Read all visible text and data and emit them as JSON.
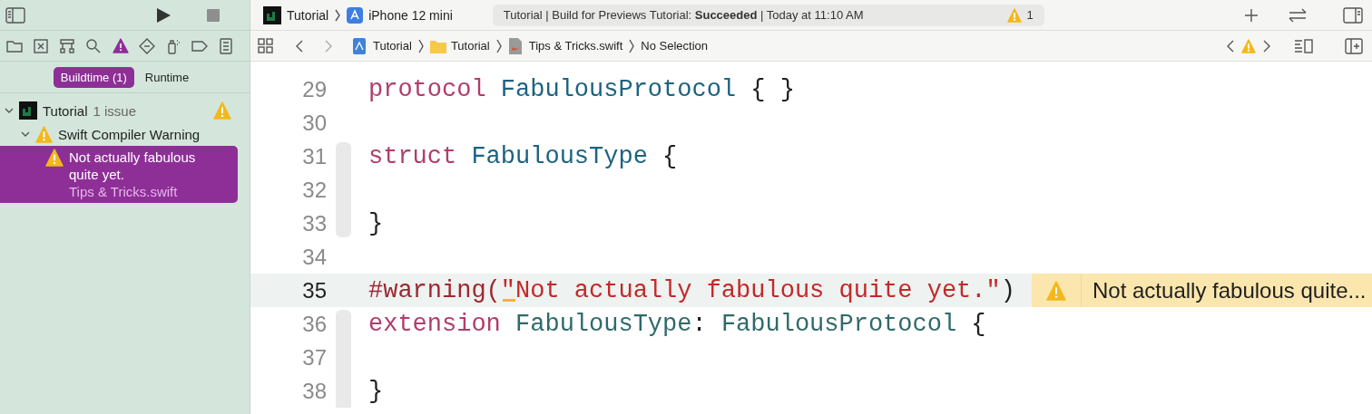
{
  "toolbar": {
    "scheme": "Tutorial",
    "device": "iPhone 12 mini",
    "status": "Tutorial | Build for Previews Tutorial: **Succeeded** | Today at 11:10 AM",
    "warning_count": "1"
  },
  "navigator_tabs": [
    {
      "kind": "folder",
      "selected": false
    },
    {
      "kind": "xbox",
      "selected": false
    },
    {
      "kind": "hierarchy",
      "selected": false
    },
    {
      "kind": "search",
      "selected": false
    },
    {
      "kind": "warning",
      "selected": true
    },
    {
      "kind": "diamond",
      "selected": false
    },
    {
      "kind": "spray",
      "selected": false
    },
    {
      "kind": "tag",
      "selected": false
    },
    {
      "kind": "list",
      "selected": false
    }
  ],
  "segments": [
    {
      "label": "Buildtime (1)",
      "selected": true
    },
    {
      "label": "Runtime",
      "selected": false
    }
  ],
  "issues": [
    {
      "kind": "project",
      "label": "Tutorial",
      "detail": "1 issue",
      "expanded": true,
      "children": [
        {
          "kind": "group",
          "label": "Swift Compiler Warning",
          "expanded": true,
          "children": [
            {
              "kind": "issue",
              "label": "Not actually fabulous quite yet.",
              "detail": "Tips & Tricks.swift",
              "selected": true
            }
          ]
        }
      ]
    }
  ],
  "jump_bar": [
    {
      "kind": "project",
      "label": "Tutorial"
    },
    {
      "kind": "folder",
      "label": "Tutorial"
    },
    {
      "kind": "swift",
      "label": "Tips & Tricks.swift"
    },
    {
      "kind": "none",
      "label": "No Selection"
    }
  ],
  "editor": {
    "lines": [
      {
        "number": "29",
        "highlighted": false,
        "ribbon": false,
        "tokens": [
          {
            "kind": "keyword",
            "text": "protocol "
          },
          {
            "kind": "decl",
            "text": "FabulousProtocol"
          },
          {
            "kind": "plain",
            "text": " { }"
          }
        ]
      },
      {
        "number": "30",
        "highlighted": false,
        "ribbon": false
      },
      {
        "number": "31",
        "highlighted": false,
        "ribbon": true,
        "tokens": [
          {
            "kind": "keyword",
            "text": "struct "
          },
          {
            "kind": "decl",
            "text": "FabulousType"
          },
          {
            "kind": "plain",
            "text": " {"
          }
        ]
      },
      {
        "number": "32",
        "highlighted": false,
        "ribbon": true
      },
      {
        "number": "33",
        "highlighted": false,
        "ribbon": true,
        "tokens": [
          {
            "kind": "plain",
            "text": "}"
          }
        ]
      },
      {
        "number": "34",
        "highlighted": false,
        "ribbon": false
      },
      {
        "number": "35",
        "highlighted": true,
        "ribbon": false,
        "tokens": [
          {
            "kind": "directive",
            "text": "#warning("
          },
          {
            "kind": "string",
            "text": "\"Not actually fabulous quite yet.\"",
            "marked": true
          },
          {
            "kind": "plain",
            "text": ")"
          }
        ],
        "annotation": "Not actually fabulous quite..."
      },
      {
        "number": "36",
        "highlighted": false,
        "ribbon": true,
        "tokens": [
          {
            "kind": "keyword",
            "text": "extension "
          },
          {
            "kind": "type",
            "text": "FabulousType"
          },
          {
            "kind": "plain",
            "text": ": "
          },
          {
            "kind": "type",
            "text": "FabulousProtocol"
          },
          {
            "kind": "plain",
            "text": " {"
          }
        ]
      },
      {
        "number": "37",
        "highlighted": false,
        "ribbon": true
      },
      {
        "number": "38",
        "highlighted": false,
        "ribbon": true,
        "tokens": [
          {
            "kind": "plain",
            "text": "}"
          }
        ]
      }
    ]
  }
}
